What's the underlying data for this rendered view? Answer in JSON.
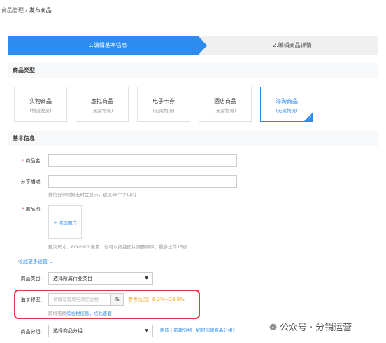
{
  "breadcrumb": {
    "parent": "商品管理",
    "sep": " / ",
    "current": "发布商品"
  },
  "steps": {
    "step1": "1.编辑基本信息",
    "step2": "2.编辑商品详情"
  },
  "sections": {
    "type": "商品类型",
    "basic": "基本信息"
  },
  "types": [
    {
      "title": "实物商品",
      "sub": "(物流发货)"
    },
    {
      "title": "虚拟商品",
      "sub": "(无需物流)"
    },
    {
      "title": "电子卡券",
      "sub": "(无需物流)"
    },
    {
      "title": "酒店商品",
      "sub": "(无需物流)"
    },
    {
      "title": "海淘商品",
      "sub": "(无需物流)",
      "active": true
    }
  ],
  "fields": {
    "name_label": "商品名:",
    "share_label": "分享描述:",
    "share_hint": "微信分享给好友时会显示，建议36个字以内",
    "image_label": "商品图:",
    "upload_text": "+ 添加图片",
    "image_hint": "建议尺寸：800*800像素，你可以拖拽图片调整顺序，最多上传15张",
    "toggle": "收起更多设置 ⌄",
    "category_label": "商品类目:",
    "category_value": "选择所属行业类目",
    "tax_label": "海关税率:",
    "tax_placeholder": "请填写跨境电商综合税",
    "tax_unit": "%",
    "tax_ref": "参考范围：6.3%~29.9%",
    "tax_hint_pre": "跨境电商",
    "tax_hint_link": "综合税信息，点此查看",
    "group_label": "商品分组:",
    "group_value": "选择商品分组",
    "group_refresh": "刷新",
    "group_new": "新建分组",
    "group_how": "如何创建商品分组?"
  },
  "watermark": {
    "text": "公众号 · 分销运营"
  },
  "icons": {
    "dropdown": "chevron-down-icon",
    "wechat": "wechat-icon"
  },
  "colors": {
    "accent": "#2d8cf0",
    "highlight": "#e4393c",
    "ref": "#f5a623"
  }
}
